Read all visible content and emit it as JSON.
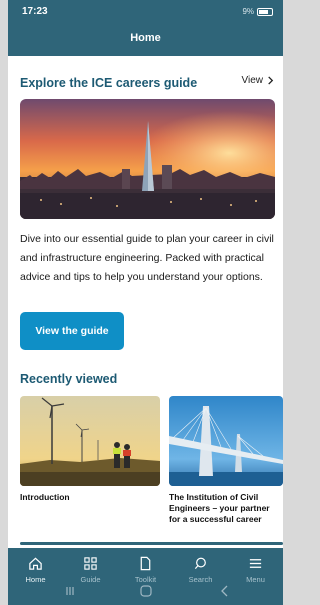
{
  "status": {
    "time": "17:23",
    "signal": "9%",
    "battery": ""
  },
  "header": {
    "title": "Home"
  },
  "careers": {
    "heading": "Explore the ICE careers guide",
    "view_label": "View",
    "description": "Dive into our essential guide to plan your career in civil and infrastructure engineering. Packed with practical advice and tips to help you understand your options.",
    "button_label": "View the guide"
  },
  "recent": {
    "heading": "Recently viewed",
    "items": [
      {
        "title": "Introduction"
      },
      {
        "title": "The Institution of Civil Engineers – your partner for a successful career"
      }
    ]
  },
  "bottom_nav": {
    "items": [
      {
        "label": "Home",
        "icon": "home-icon",
        "active": true
      },
      {
        "label": "Guide",
        "icon": "grid-icon",
        "active": false
      },
      {
        "label": "Toolkit",
        "icon": "document-icon",
        "active": false
      },
      {
        "label": "Search",
        "icon": "search-icon",
        "active": false
      },
      {
        "label": "Menu",
        "icon": "menu-icon",
        "active": false
      }
    ]
  },
  "colors": {
    "header": "#2f6579",
    "heading": "#1d5a73",
    "button": "#0f8fc6"
  }
}
